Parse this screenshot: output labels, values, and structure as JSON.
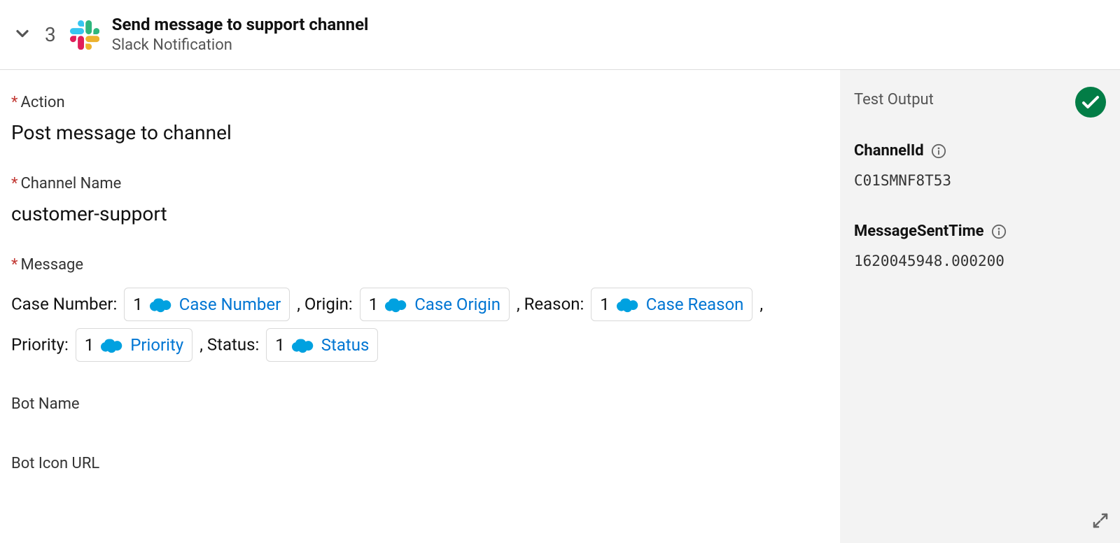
{
  "header": {
    "step_number": "3",
    "title": "Send message to support channel",
    "subtitle": "Slack Notification"
  },
  "fields": {
    "action_label": "Action",
    "action_value": "Post message to channel",
    "channel_label": "Channel Name",
    "channel_value": "customer-support",
    "message_label": "Message",
    "bot_name_label": "Bot Name",
    "bot_icon_label": "Bot Icon URL"
  },
  "message_parts": {
    "case_number_text": "Case Number: ",
    "origin_text": " , Origin: ",
    "reason_text": " , Reason: ",
    "priority_text": "Priority: ",
    "status_text": " , Status: "
  },
  "pills": {
    "case_number": {
      "num": "1",
      "label": "Case Number"
    },
    "case_origin": {
      "num": "1",
      "label": "Case Origin"
    },
    "case_reason": {
      "num": "1",
      "label": "Case Reason"
    },
    "priority": {
      "num": "1",
      "label": "Priority"
    },
    "status": {
      "num": "1",
      "label": "Status"
    }
  },
  "trailing_comma": " ,",
  "side": {
    "title": "Test Output",
    "channel_id_label": "ChannelId",
    "channel_id_value": "C01SMNF8T53",
    "msg_time_label": "MessageSentTime",
    "msg_time_value": "1620045948.000200"
  }
}
